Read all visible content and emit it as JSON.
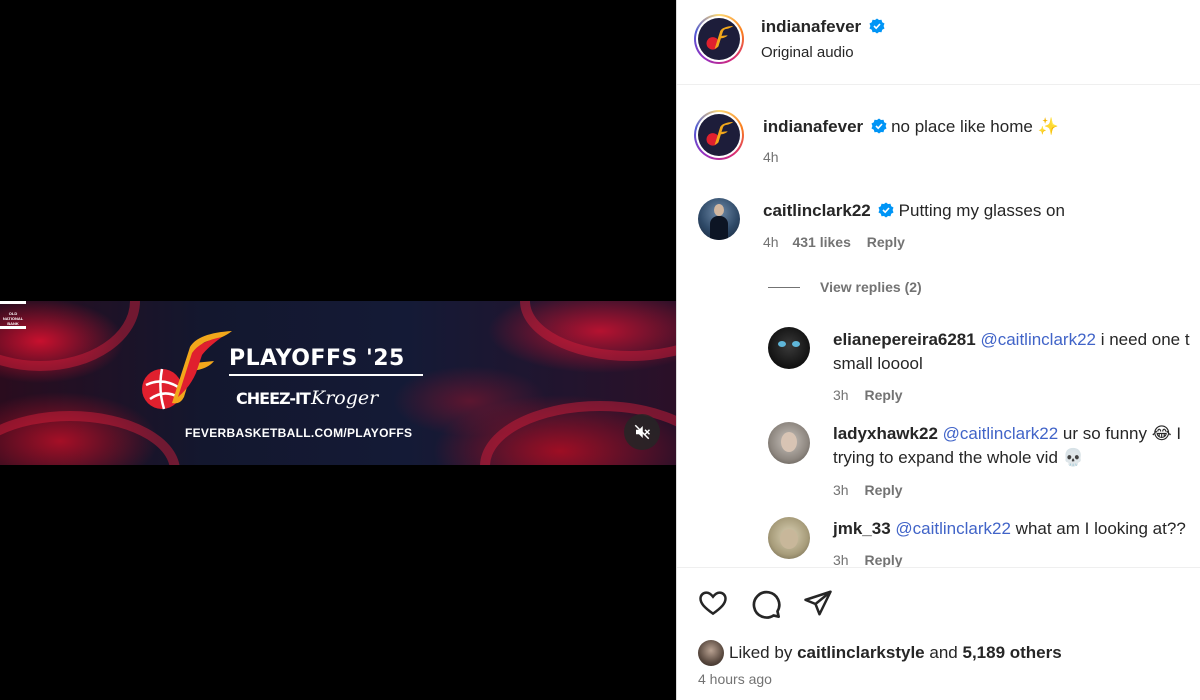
{
  "media": {
    "banner_title": "PLAYOFFS '25",
    "sponsors": [
      "CHEEZ-IT",
      "Kroger"
    ],
    "bank_label": "OLD NATIONAL BANK",
    "banner_url": "FEVERBASKETBALL.COM/PLAYOFFS",
    "mute_icon": "speaker-muted-icon"
  },
  "header": {
    "username": "indianafever",
    "subtitle": "Original audio"
  },
  "caption": {
    "username": "indianafever",
    "text": "no place like home ✨",
    "time": "4h"
  },
  "comments": [
    {
      "username": "caitlinclark22",
      "verified": true,
      "text": "Putting my glasses on",
      "time": "4h",
      "likes": "431 likes",
      "reply": "Reply",
      "view_replies": "View replies (2)"
    },
    {
      "username": "elianepereira6281",
      "mention": "@caitlinclark22",
      "text": "i need one t",
      "text_line2": "small looool",
      "time": "3h",
      "reply": "Reply"
    },
    {
      "username": "ladyxhawk22",
      "mention": "@caitlinclark22",
      "text": "ur so funny 😂 I",
      "text_line2": "trying to expand the whole vid 💀",
      "time": "3h",
      "reply": "Reply"
    },
    {
      "username": "jmk_33",
      "mention": "@caitlinclark22",
      "text": "what am I looking at??",
      "time": "3h",
      "reply": "Reply"
    }
  ],
  "footer": {
    "liked_by_prefix": "Liked by",
    "liked_by_user": "caitlinclarkstyle",
    "and": "and",
    "others": "5,189 others",
    "time_ago": "4 hours ago"
  },
  "colors": {
    "verified": "#0095f6",
    "mention": "#4164c8",
    "muted_text": "#737373"
  }
}
